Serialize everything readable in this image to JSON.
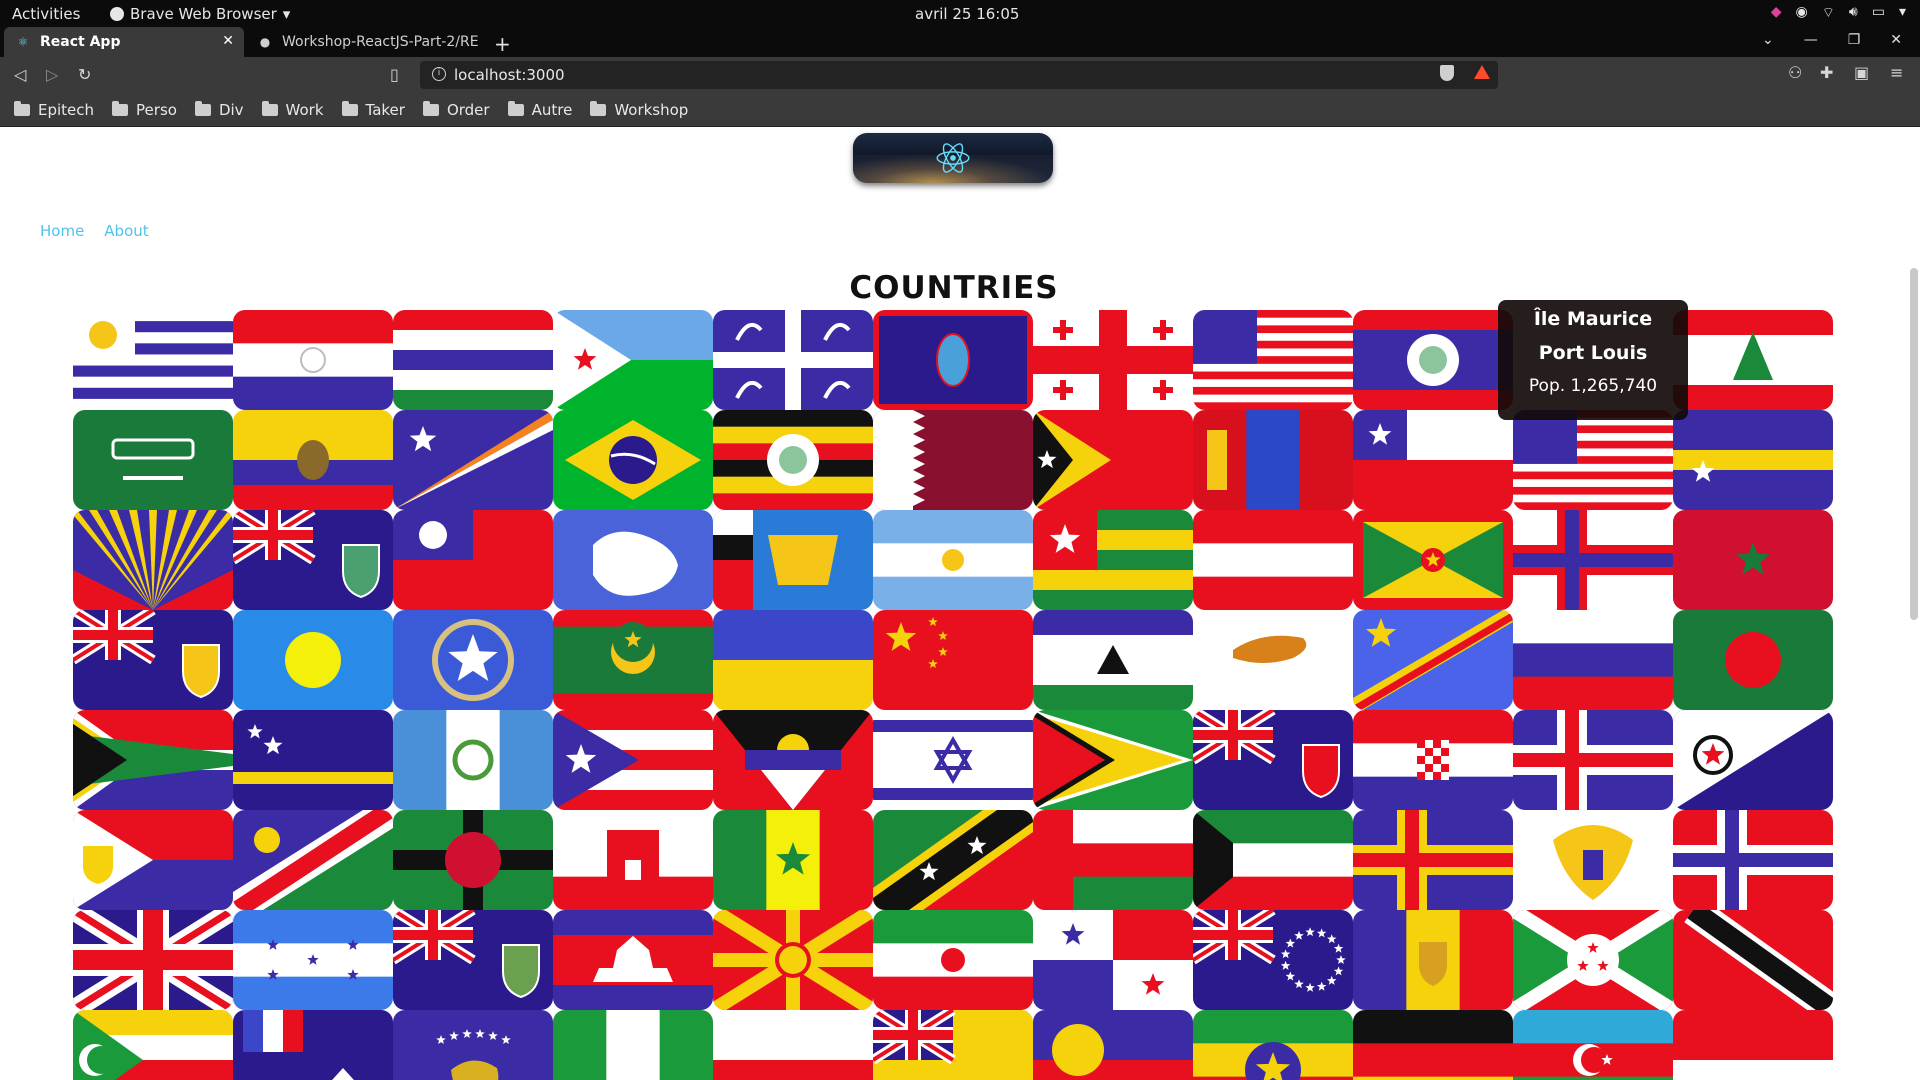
{
  "system_bar": {
    "activities": "Activities",
    "app_name": "Brave Web Browser",
    "clock": "avril 25  16:05"
  },
  "browser": {
    "tabs": [
      {
        "title": "React App"
      },
      {
        "title": "Workshop-ReactJS-Part-2/RE"
      }
    ],
    "url": "localhost:3000",
    "bookmarks": [
      "Epitech",
      "Perso",
      "Div",
      "Work",
      "Taker",
      "Order",
      "Autre",
      "Workshop"
    ]
  },
  "page": {
    "nav": {
      "home": "Home",
      "about": "About"
    },
    "heading": "COUNTRIES",
    "tooltip": {
      "name": "Île Maurice",
      "capital": "Port Louis",
      "population": "Pop. 1,265,740"
    },
    "flags": [
      {
        "kind": "stripes-h",
        "colors": [
          "#ffffff",
          "#3b2ca6",
          "#ffffff",
          "#3b2ca6",
          "#ffffff",
          "#3b2ca6",
          "#ffffff",
          "#3b2ca6",
          "#ffffff"
        ],
        "canton": "#ffffff",
        "emblem": "sun",
        "emblemColor": "#f5c518"
      },
      {
        "kind": "stripes-h",
        "colors": [
          "#e8101e",
          "#ffffff",
          "#3b2ca6"
        ],
        "emblem": "circle-center",
        "emblemColor": "#bdbdbd"
      },
      {
        "kind": "stripes-h",
        "colors": [
          "#e8101e",
          "#ffffff",
          "#3b2ca6",
          "#ffffff",
          "#1a8a3a"
        ]
      },
      {
        "kind": "triangle-left",
        "colors": [
          "#6aa8e8",
          "#00b32c"
        ],
        "tri": "#ffffff",
        "emblem": "star-left",
        "emblemColor": "#e8101e"
      },
      {
        "kind": "quarters",
        "colors": [
          "#3b2ca6",
          "#3b2ca6",
          "#3b2ca6",
          "#3b2ca6"
        ],
        "cross": "#ffffff"
      },
      {
        "kind": "solid-border",
        "colors": [
          "#2a1a8c"
        ],
        "border": "#e8101e",
        "emblem": "oval",
        "emblemColor": "#4aa0d8"
      },
      {
        "kind": "cross-center",
        "colors": [
          "#ffffff"
        ],
        "cross": "#e8101e",
        "emblem": "small-crosses",
        "emblemColor": "#e8101e"
      },
      {
        "kind": "usa",
        "colors": [
          "#e8101e",
          "#ffffff"
        ],
        "canton": "#3b2ca6"
      },
      {
        "kind": "stripes-h",
        "colors": [
          "#e8101e",
          "#3b2ca6",
          "#3b2ca6",
          "#3b2ca6",
          "#e8101e"
        ],
        "emblem": "circle-white",
        "emblemColor": "#ffffff"
      },
      {
        "kind": "stripes-h",
        "colors": [
          "#ffffff",
          "#ffffff"
        ]
      },
      {
        "kind": "stripes-h",
        "colors": [
          "#e8101e",
          "#ffffff",
          "#ffffff",
          "#e8101e"
        ],
        "emblem": "cedar",
        "emblemColor": "#1a8a3a"
      },
      {
        "kind": "solid",
        "colors": [
          "#1a7a3a"
        ],
        "emblem": "text-white",
        "emblemColor": "#ffffff"
      },
      {
        "kind": "stripes-h",
        "colors": [
          "#f5d20c",
          "#f5d20c",
          "#3b2ca6",
          "#e8101e"
        ],
        "emblem": "condor",
        "emblemColor": "#8a6a2a"
      },
      {
        "kind": "diag-marshall",
        "colors": [
          "#3b2ca6"
        ],
        "emblem": "star-left-white",
        "emblemColor": "#ffffff"
      },
      {
        "kind": "brazil",
        "colors": [
          "#00b32c",
          "#f5d20c",
          "#2a1a8c"
        ]
      },
      {
        "kind": "stripes-h",
        "colors": [
          "#111111",
          "#f5d20c",
          "#e8101e",
          "#111111",
          "#f5d20c",
          "#e8101e"
        ],
        "emblem": "circle-white",
        "emblemColor": "#ffffff"
      },
      {
        "kind": "qatar",
        "colors": [
          "#ffffff",
          "#8a1030"
        ]
      },
      {
        "kind": "triangle-left",
        "colors": [
          "#e8101e",
          "#e8101e"
        ],
        "tri": "#f5d20c",
        "emblem": "black-tri",
        "emblemColor": "#111111"
      },
      {
        "kind": "stripes-v",
        "colors": [
          "#d8101e",
          "#2a48c8",
          "#d8101e"
        ],
        "emblem": "soyombo",
        "emblemColor": "#f5c518"
      },
      {
        "kind": "chile",
        "colors": [
          "#ffffff",
          "#e8101e"
        ],
        "canton": "#3b2ca6"
      },
      {
        "kind": "usa",
        "colors": [
          "#e8101e",
          "#ffffff"
        ],
        "canton": "#3b2ca6"
      },
      {
        "kind": "stripes-h",
        "colors": [
          "#3b2ca6",
          "#3b2ca6",
          "#f5d20c",
          "#3b2ca6",
          "#3b2ca6"
        ],
        "emblem": "star-white-lowleft",
        "emblemColor": "#ffffff"
      },
      {
        "kind": "reunion",
        "colors": [
          "#3b2ca6",
          "#e8101e",
          "#f5d20c"
        ]
      },
      {
        "kind": "ensign",
        "colors": [
          "#2a1a8c"
        ],
        "emblem": "shield-right",
        "emblemColor": "#4aa070"
      },
      {
        "kind": "taiwan",
        "colors": [
          "#e8101e",
          "#3b2ca6"
        ]
      },
      {
        "kind": "solid",
        "colors": [
          "#4a63d8"
        ],
        "emblem": "antarctica",
        "emblemColor": "#ffffff"
      },
      {
        "kind": "solid",
        "colors": [
          "#2a7ad8"
        ],
        "emblem": "ship",
        "emblemColor": "#f5c518"
      },
      {
        "kind": "stripes-h",
        "colors": [
          "#7ab0e8",
          "#ffffff",
          "#7ab0e8"
        ],
        "emblem": "sun-center",
        "emblemColor": "#f5c518"
      },
      {
        "kind": "togo",
        "colors": [
          "#1a8a3a",
          "#f5d20c",
          "#1a8a3a",
          "#f5d20c",
          "#1a8a3a"
        ],
        "canton": "#e8101e"
      },
      {
        "kind": "stripes-h",
        "colors": [
          "#e8101e",
          "#ffffff",
          "#e8101e"
        ]
      },
      {
        "kind": "grenada",
        "colors": [
          "#e8101e",
          "#f5d20c",
          "#1a8a3a"
        ]
      },
      {
        "kind": "nordic",
        "colors": [
          "#ffffff"
        ],
        "cross": "#e8101e",
        "cross2": "#3b2ca6"
      },
      {
        "kind": "solid",
        "colors": [
          "#d0102e"
        ],
        "emblem": "pentagram",
        "emblemColor": "#1a7a3a"
      },
      {
        "kind": "ensign",
        "colors": [
          "#2a1a8c"
        ],
        "emblem": "shield-right",
        "emblemColor": "#f5c518"
      },
      {
        "kind": "solid",
        "colors": [
          "#2a8ae8"
        ],
        "emblem": "disc-center",
        "emblemColor": "#f5f00a"
      },
      {
        "kind": "solid",
        "colors": [
          "#3a5ad8"
        ],
        "emblem": "star-white-big",
        "emblemColor": "#ffffff"
      },
      {
        "kind": "stripes-h",
        "colors": [
          "#e8101e",
          "#1a7a3a",
          "#1a7a3a",
          "#1a7a3a",
          "#1a7a3a",
          "#e8101e"
        ],
        "emblem": "crescent",
        "emblemColor": "#f5c518"
      },
      {
        "kind": "stripes-h",
        "colors": [
          "#3b46c8",
          "#f5d20c"
        ]
      },
      {
        "kind": "solid",
        "colors": [
          "#e8101e"
        ],
        "emblem": "china",
        "emblemColor": "#f5d20c"
      },
      {
        "kind": "stripes-h",
        "colors": [
          "#3b2ca6",
          "#ffffff",
          "#ffffff",
          "#1a8a3a"
        ],
        "emblem": "hat",
        "emblemColor": "#111111"
      },
      {
        "kind": "solid",
        "colors": [
          "#ffffff"
        ],
        "emblem": "island",
        "emblemColor": "#d8801a"
      },
      {
        "kind": "drc",
        "colors": [
          "#4a63e8",
          "#f5d20c",
          "#e8101e"
        ]
      },
      {
        "kind": "stripes-h",
        "colors": [
          "#ffffff",
          "#3b2ca6",
          "#e8101e"
        ]
      },
      {
        "kind": "solid",
        "colors": [
          "#1a7a3a"
        ],
        "emblem": "disc-center",
        "emblemColor": "#e8101e"
      },
      {
        "kind": "southafrica",
        "colors": [
          "#e8101e",
          "#3b2ca6",
          "#1a8a3a",
          "#f5d20c",
          "#111111",
          "#ffffff"
        ]
      },
      {
        "kind": "curacao",
        "colors": [
          "#2a1a8c",
          "#f5d20c"
        ]
      },
      {
        "kind": "stripes-v",
        "colors": [
          "#4a90d8",
          "#ffffff",
          "#4a90d8"
        ],
        "emblem": "wreath",
        "emblemColor": "#4a9a3a"
      },
      {
        "kind": "puertorico",
        "colors": [
          "#e8101e",
          "#ffffff",
          "#3b2ca6"
        ]
      },
      {
        "kind": "antigua",
        "colors": [
          "#e8101e",
          "#111111",
          "#3b2ca6",
          "#ffffff",
          "#f5d20c"
        ]
      },
      {
        "kind": "israel",
        "colors": [
          "#ffffff",
          "#3b2ca6"
        ]
      },
      {
        "kind": "guyana",
        "colors": [
          "#1a9a3a",
          "#ffffff",
          "#f5d20c",
          "#111111",
          "#e8101e"
        ]
      },
      {
        "kind": "ensign",
        "colors": [
          "#2a1a8c"
        ],
        "emblem": "shield-right",
        "emblemColor": "#e8101e"
      },
      {
        "kind": "stripes-h",
        "colors": [
          "#e8101e",
          "#ffffff",
          "#3b2ca6"
        ],
        "emblem": "checker",
        "emblemColor": "#e8101e"
      },
      {
        "kind": "nordic",
        "colors": [
          "#3b2ca6"
        ],
        "cross": "#ffffff",
        "cross2": "#e8101e"
      },
      {
        "kind": "diag-split",
        "colors": [
          "#ffffff",
          "#2a1a8c"
        ],
        "emblem": "gear-left",
        "emblemColor": "#e8101e"
      },
      {
        "kind": "sxm",
        "colors": [
          "#e8101e",
          "#3b2ca6",
          "#ffffff"
        ]
      },
      {
        "kind": "namibia",
        "colors": [
          "#3b2ca6",
          "#e8101e",
          "#1a8a3a",
          "#ffffff"
        ],
        "emblem": "sun-ul",
        "emblemColor": "#f5d20c"
      },
      {
        "kind": "stripes-v",
        "colors": [
          "#1a8a3a",
          "#1a8a3a",
          "#1a8a3a"
        ],
        "cross": "#111111",
        "emblem": "disc-center",
        "emblemColor": "#d01030"
      },
      {
        "kind": "stripes-h",
        "colors": [
          "#ffffff",
          "#ffffff",
          "#e8101e"
        ],
        "emblem": "castle",
        "emblemColor": "#e8101e"
      },
      {
        "kind": "stripes-v",
        "colors": [
          "#1a8a3a",
          "#f5f00a",
          "#e8101e"
        ],
        "emblem": "star-center-green",
        "emblemColor": "#1a8a3a"
      },
      {
        "kind": "stkitts",
        "colors": [
          "#1a8a3a",
          "#e8101e",
          "#f5d20c",
          "#111111"
        ]
      },
      {
        "kind": "oman",
        "colors": [
          "#e8101e",
          "#ffffff",
          "#1a8a3a"
        ]
      },
      {
        "kind": "kuwait",
        "colors": [
          "#1a8a3a",
          "#ffffff",
          "#e8101e",
          "#111111"
        ]
      },
      {
        "kind": "nordic",
        "colors": [
          "#3b2ca6"
        ],
        "cross": "#f5d20c",
        "cross2": "#e8101e"
      },
      {
        "kind": "solid",
        "colors": [
          "#ffffff"
        ],
        "emblem": "eagle",
        "emblemColor": "#f5c518"
      },
      {
        "kind": "nordic",
        "colors": [
          "#e8101e"
        ],
        "cross": "#ffffff",
        "cross2": "#3b2ca6"
      },
      {
        "kind": "uk",
        "colors": [
          "#2a1a8c",
          "#ffffff",
          "#e8101e"
        ]
      },
      {
        "kind": "stripes-h",
        "colors": [
          "#3b7ae8",
          "#ffffff",
          "#3b7ae8"
        ],
        "emblem": "stars5",
        "emblemColor": "#3b2ca6"
      },
      {
        "kind": "ensign",
        "colors": [
          "#2a1a8c"
        ],
        "emblem": "shield-right",
        "emblemColor": "#6aa050"
      },
      {
        "kind": "stripes-h",
        "colors": [
          "#3b2ca6",
          "#e8101e",
          "#e8101e",
          "#3b2ca6"
        ],
        "emblem": "temple",
        "emblemColor": "#ffffff"
      },
      {
        "kind": "macedonia",
        "colors": [
          "#e8101e",
          "#f5d20c"
        ]
      },
      {
        "kind": "stripes-h",
        "colors": [
          "#1a9a3a",
          "#ffffff",
          "#e8101e"
        ],
        "emblem": "emblem-red",
        "emblemColor": "#e8101e"
      },
      {
        "kind": "panama",
        "colors": [
          "#ffffff",
          "#e8101e",
          "#3b2ca6"
        ]
      },
      {
        "kind": "ensign",
        "colors": [
          "#2a1a8c"
        ],
        "emblem": "ring-stars",
        "emblemColor": "#ffffff"
      },
      {
        "kind": "stripes-v",
        "colors": [
          "#3b2ca6",
          "#f5d20c",
          "#e8101e"
        ],
        "emblem": "shield-center",
        "emblemColor": "#d8a020"
      },
      {
        "kind": "burundi",
        "colors": [
          "#e8101e",
          "#1a9a3a",
          "#ffffff"
        ]
      },
      {
        "kind": "trinidad",
        "colors": [
          "#e8101e",
          "#111111",
          "#ffffff"
        ]
      },
      {
        "kind": "comoros",
        "colors": [
          "#f5d20c",
          "#ffffff",
          "#e8101e",
          "#3b2ca6",
          "#1a9a3a"
        ]
      },
      {
        "kind": "solid",
        "colors": [
          "#2a1a8c"
        ],
        "emblem": "french-canton",
        "emblemColor": "#ffffff"
      },
      {
        "kind": "solid",
        "colors": [
          "#3b2ca6"
        ],
        "emblem": "kosovo",
        "emblemColor": "#d8b020"
      },
      {
        "kind": "stripes-v",
        "colors": [
          "#1a9a3a",
          "#ffffff",
          "#1a9a3a"
        ]
      },
      {
        "kind": "stripes-h",
        "colors": [
          "#ffffff",
          "#e8101e"
        ]
      },
      {
        "kind": "ensign",
        "colors": [
          "#f5d20c"
        ]
      },
      {
        "kind": "stripes-h",
        "colors": [
          "#3b2ca6",
          "#e8101e"
        ],
        "emblem": "disc-left",
        "emblemColor": "#f5d20c"
      },
      {
        "kind": "stripes-h",
        "colors": [
          "#1a9a3a",
          "#f5d20c",
          "#e8101e"
        ],
        "emblem": "disc-center-blue",
        "emblemColor": "#3b2ca6"
      },
      {
        "kind": "stripes-h",
        "colors": [
          "#111111",
          "#e8101e",
          "#f5d20c"
        ]
      },
      {
        "kind": "stripes-h",
        "colors": [
          "#30a8d8",
          "#e8101e",
          "#1a9a3a"
        ],
        "emblem": "crescent-white",
        "emblemColor": "#ffffff"
      },
      {
        "kind": "stripes-h",
        "colors": [
          "#e8101e",
          "#ffffff"
        ]
      }
    ]
  }
}
